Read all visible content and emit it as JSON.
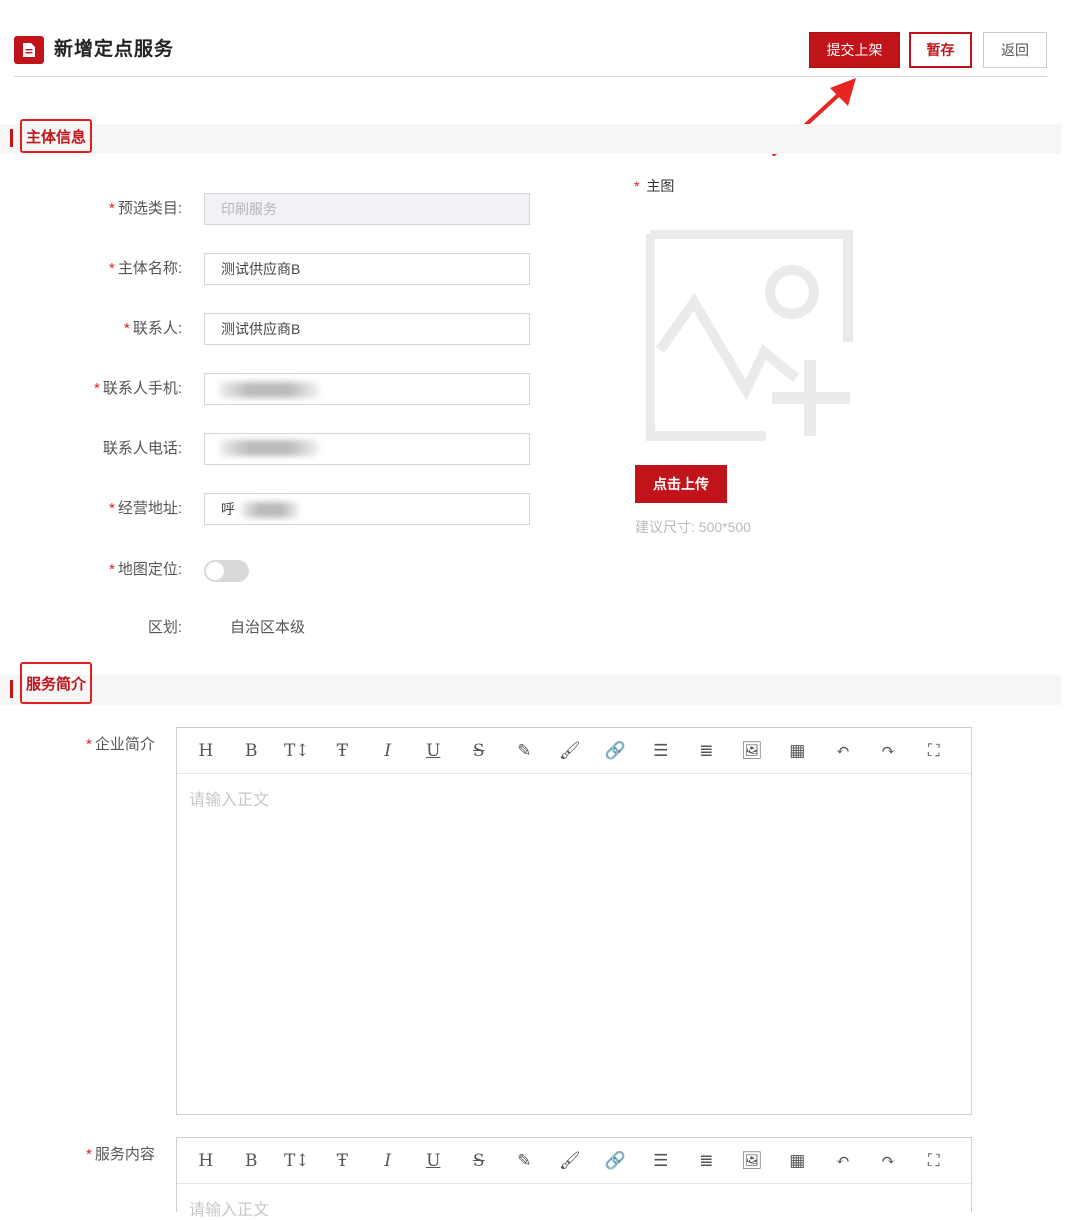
{
  "header": {
    "title": "新增定点服务",
    "submit_label": "提交上架",
    "save_label": "暂存",
    "back_label": "返回"
  },
  "sections": {
    "main_info": "主体信息",
    "service_intro": "服务简介"
  },
  "form": {
    "category": {
      "label": "预选类目:",
      "value": "印刷服务",
      "required": true
    },
    "entity_name": {
      "label": "主体名称:",
      "value": "测试供应商B",
      "required": true
    },
    "contact": {
      "label": "联系人:",
      "value": "测试供应商B",
      "required": true
    },
    "contact_mobile": {
      "label": "联系人手机:",
      "value": "",
      "required": true
    },
    "contact_phone": {
      "label": "联系人电话:",
      "value": "",
      "required": false
    },
    "address": {
      "label": "经营地址:",
      "value": "呼",
      "required": true
    },
    "map_location": {
      "label": "地图定位:",
      "enabled": false,
      "required": true
    },
    "region": {
      "label": "区划:",
      "value": "自治区本级"
    }
  },
  "image_upload": {
    "label": "主图",
    "button_label": "点击上传",
    "hint": "建议尺寸: 500*500"
  },
  "editors": {
    "company_intro": {
      "label": "企业简介",
      "placeholder": "请输入正文"
    },
    "service_content": {
      "label": "服务内容",
      "placeholder": "请输入正文"
    },
    "toolbar": [
      "H",
      "B",
      "T↕",
      "Ŧ",
      "I",
      "U",
      "S",
      "✎",
      "🖌",
      "🔗",
      "☰",
      "≣",
      "🖼",
      "▦",
      "↶",
      "↷",
      "⛶"
    ]
  },
  "colors": {
    "accent": "#c0141a",
    "highlight_border": "#e02020"
  }
}
